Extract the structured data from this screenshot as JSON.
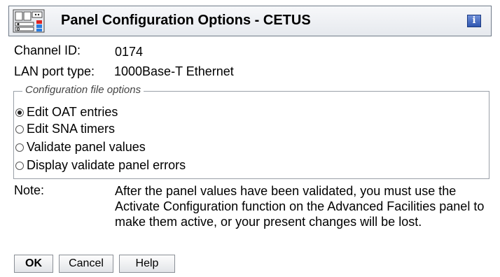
{
  "window": {
    "title": "Panel Configuration Options - CETUS",
    "app_icon": "panel-config-icon",
    "info_icon": "i"
  },
  "fields": {
    "channel_id_label": "Channel ID:",
    "channel_id_value": "0174",
    "lan_port_label": "LAN port type:",
    "lan_port_value": "1000Base-T Ethernet"
  },
  "options": {
    "legend": "Configuration file options",
    "items": [
      {
        "label": "Edit OAT entries",
        "checked": true
      },
      {
        "label": "Edit SNA timers",
        "checked": false
      },
      {
        "label": "Validate panel values",
        "checked": false
      },
      {
        "label": "Display validate panel errors",
        "checked": false
      }
    ]
  },
  "note": {
    "label": "Note:",
    "text": "After the panel values have been validated, you must use the Activate Configuration function on the Advanced Facilities panel to make them active, or your present changes will be lost."
  },
  "buttons": {
    "ok": "OK",
    "cancel": "Cancel",
    "help": "Help"
  }
}
